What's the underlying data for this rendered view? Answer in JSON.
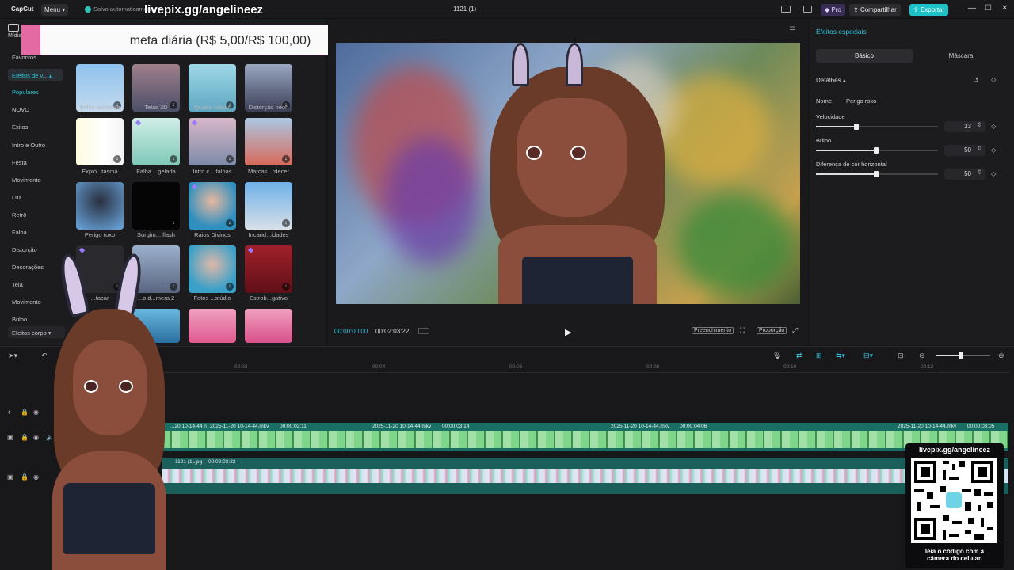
{
  "app": {
    "logo": "CapCut",
    "menu": "Menu",
    "saved_status": "Salvo automaticamente",
    "project_title": "1121 (1)"
  },
  "overlay": {
    "stream_url": "livepix.gg/angelineez",
    "goal_text": "meta diária (R$ 5,00/R$ 100,00)",
    "qr_url": "livepix.gg/angelineez",
    "qr_caption_line1": "leia o código com a",
    "qr_caption_line2": "câmera do celular."
  },
  "topbar": {
    "pro_label": "Pro",
    "share_label": "Compartilhar",
    "export_label": "Exportar"
  },
  "sidebar": {
    "media_tab": "Mídia",
    "items": [
      "Favoritos",
      "Efeitos de v...",
      "Populares",
      "NOVO",
      "Exitos",
      "Intro e Outro",
      "Festa",
      "Movimento",
      "Luz",
      "Retrô",
      "Falha",
      "Distorção",
      "Decorações",
      "Tela",
      "Movimento",
      "Brilho"
    ],
    "bottom": "Efeitos corpo"
  },
  "effects": [
    {
      "label": "Brilho oscilante"
    },
    {
      "label": "Telas 3D"
    },
    {
      "label": "Quatro caixas"
    },
    {
      "label": "Distorção néon"
    },
    {
      "label": "Explo...tasma"
    },
    {
      "label": "Falha ...gelada"
    },
    {
      "label": "Intro c... falhas"
    },
    {
      "label": "Marcas...rdecer"
    },
    {
      "label": "Perigo roxo"
    },
    {
      "label": "Surgim... flash"
    },
    {
      "label": "Raios Divinos"
    },
    {
      "label": "Incand...idades"
    },
    {
      "label": "...tacar"
    },
    {
      "label": "...o d...mera 2"
    },
    {
      "label": "Fotos ...stúdio"
    },
    {
      "label": "Estrob...gativo"
    }
  ],
  "player": {
    "current_time": "00:00:00:00",
    "total_time": "00:02:03:22",
    "fill_label": "Preenchimento",
    "ratio_label": "Proporção"
  },
  "right_panel": {
    "title": "Efeitos especiais",
    "tab_basic": "Básico",
    "tab_mask": "Máscara",
    "section": "Detalhes",
    "name_label": "Nome",
    "name_value": "Perigo roxo",
    "speed_label": "Velocidade",
    "speed_value": "33",
    "brightness_label": "Brilho",
    "brightness_value": "50",
    "hcolor_label": "Diferença de cor horizontal",
    "hcolor_value": "50"
  },
  "timeline": {
    "ruler": [
      "00:03",
      "00:04",
      "00:06",
      "00:08",
      "00:10",
      "00:12"
    ],
    "clips_main": [
      {
        "name": "...20 10-14-44 n",
        "dur": ""
      },
      {
        "name": "2025-11-20 10-14-44.mkv",
        "dur": "00:00:02:11"
      },
      {
        "name": "2025-11-20 10-14-44.mkv",
        "dur": "00:00:03:14"
      },
      {
        "name": "2025-11-20 10-14-44.mkv",
        "dur": "00:00:04:06"
      },
      {
        "name": "2025-11-20 10-14-44.mkv",
        "dur": "00:00:03:05"
      }
    ],
    "clip_bg": {
      "name": "1121 (1).jpg",
      "dur": "00:02:03:22"
    }
  },
  "colors": {
    "accent": "#2ec4d8",
    "export": "#1fc1c8",
    "track_main": "#1a6f64"
  }
}
